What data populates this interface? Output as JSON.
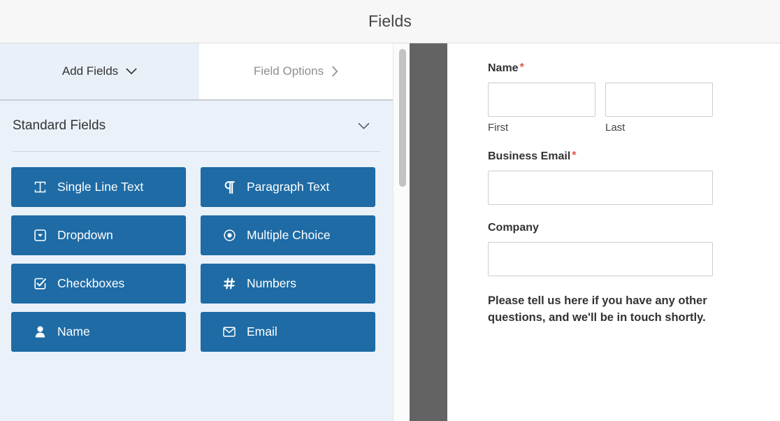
{
  "header": {
    "title": "Fields"
  },
  "builder": {
    "tabs": [
      {
        "label": "Add Fields",
        "icon": "chevron-down-icon",
        "active": true
      },
      {
        "label": "Field Options",
        "icon": "chevron-right-icon",
        "active": false
      }
    ],
    "sections": [
      {
        "title": "Standard Fields",
        "icon": "chevron-down-icon",
        "fields": [
          {
            "label": "Single Line Text",
            "icon": "text-cursor-icon"
          },
          {
            "label": "Paragraph Text",
            "icon": "pilcrow-icon"
          },
          {
            "label": "Dropdown",
            "icon": "dropdown-caret-icon"
          },
          {
            "label": "Multiple Choice",
            "icon": "radio-button-icon"
          },
          {
            "label": "Checkboxes",
            "icon": "checkbox-checked-icon"
          },
          {
            "label": "Numbers",
            "icon": "hash-icon"
          },
          {
            "label": "Name",
            "icon": "user-icon"
          },
          {
            "label": "Email",
            "icon": "envelope-icon"
          }
        ]
      }
    ],
    "colors": {
      "field_button": "#1e6ba5",
      "active_tab": "#e9f0f8",
      "panel": "#eaf1f9"
    }
  },
  "preview": {
    "fields": [
      {
        "type": "name",
        "label": "Name",
        "required": true,
        "required_mark": "*",
        "subfields": [
          {
            "sublabel": "First",
            "value": ""
          },
          {
            "sublabel": "Last",
            "value": ""
          }
        ]
      },
      {
        "type": "email",
        "label": "Business Email",
        "required": true,
        "required_mark": "*",
        "value": ""
      },
      {
        "type": "text",
        "label": "Company",
        "required": false,
        "required_mark": "",
        "value": ""
      },
      {
        "type": "html",
        "text": "Please tell us here if you have any other questions, and we'll be in touch shortly."
      }
    ]
  }
}
